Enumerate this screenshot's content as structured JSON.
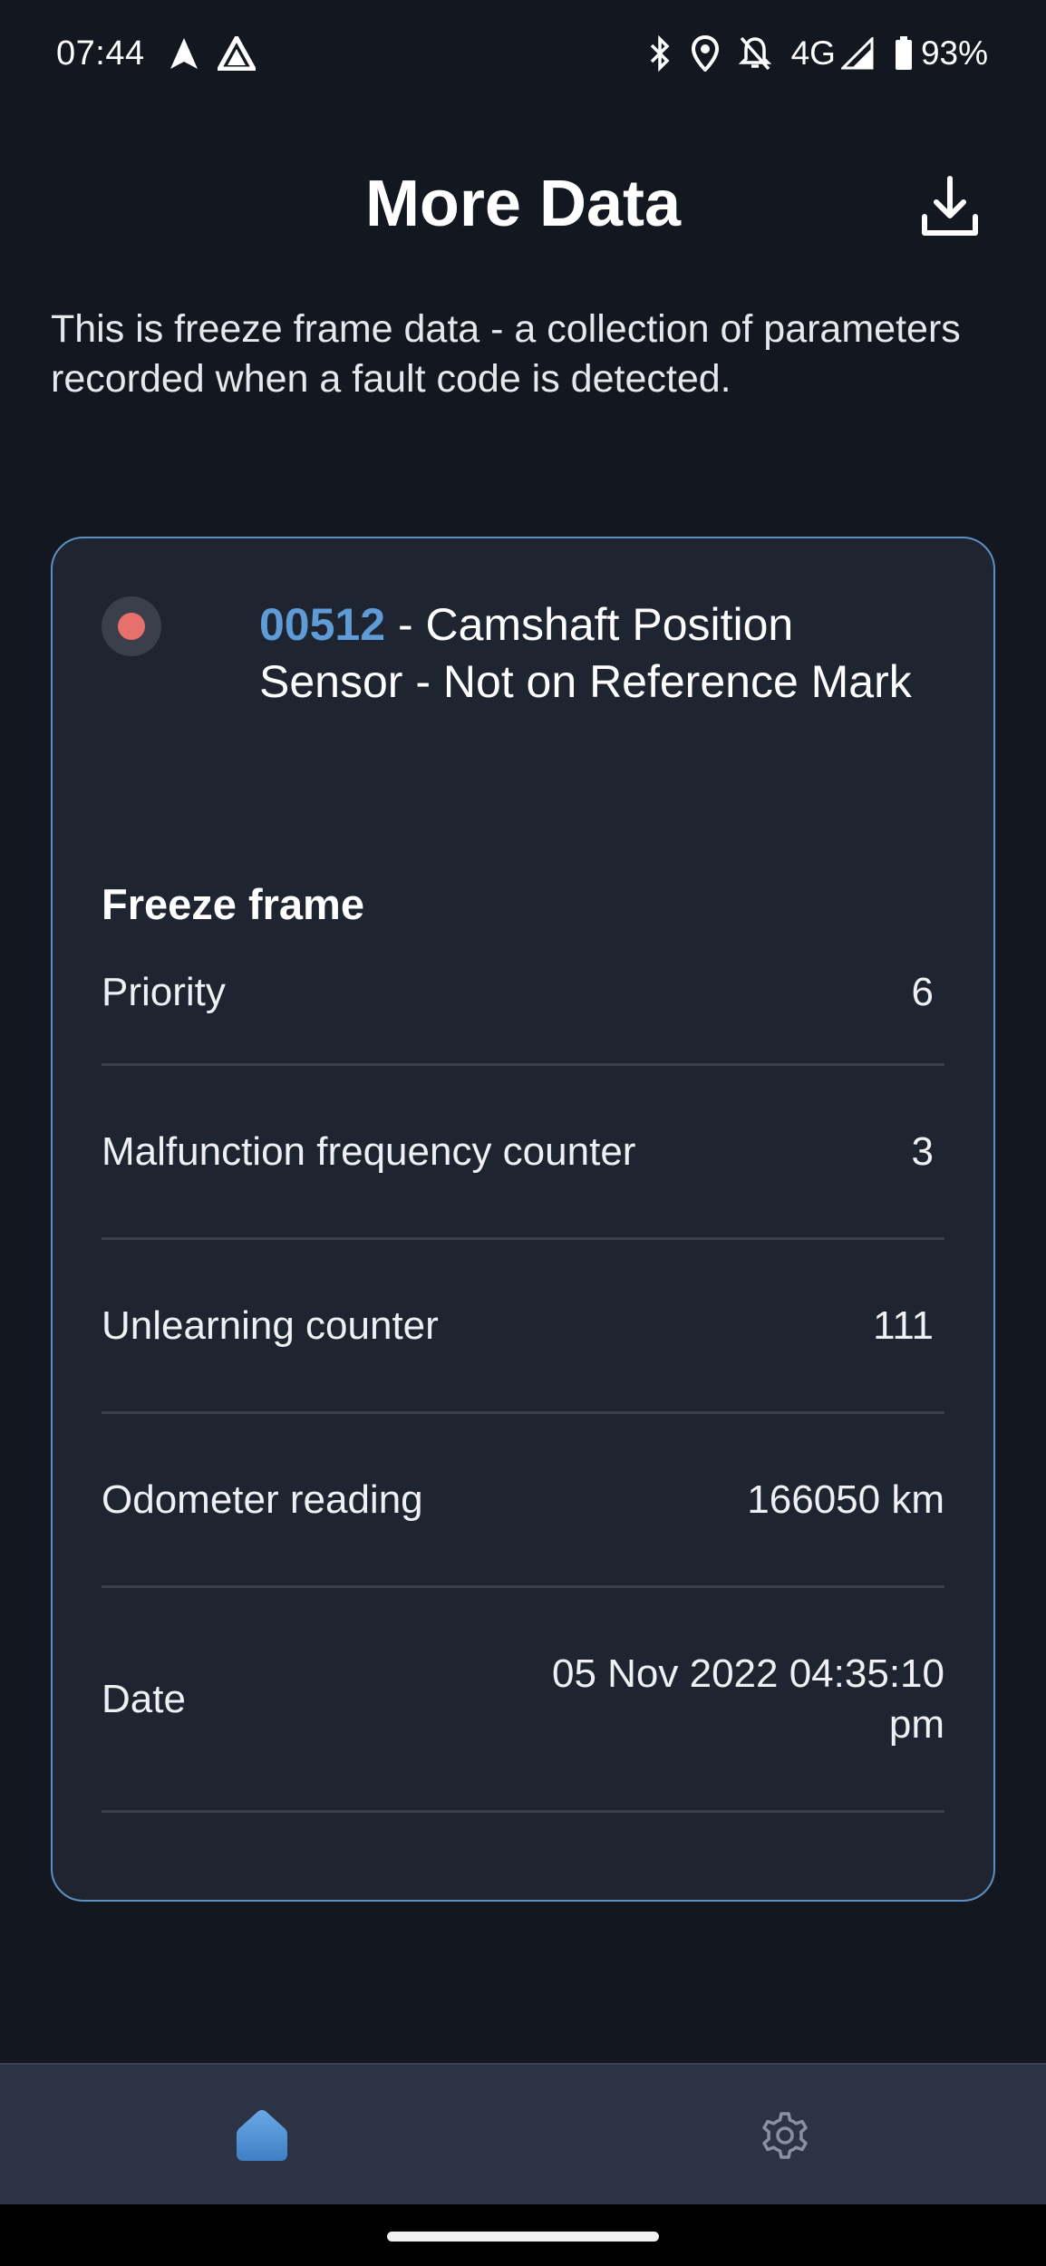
{
  "status_bar": {
    "time": "07:44",
    "network": "4G",
    "battery": "93%",
    "icons": [
      "navigation-icon",
      "app-icon",
      "bluetooth-icon",
      "location-icon",
      "notifications-off-icon",
      "signal-icon",
      "battery-icon"
    ]
  },
  "header": {
    "title": "More Data",
    "download_icon": "download-icon"
  },
  "intro": {
    "text": "This is freeze frame data - a collection of parameters recorded when a fault code is detected."
  },
  "fault": {
    "code": "00512",
    "separator": " - ",
    "description": "Camshaft Position Sensor - Not on Reference Mark",
    "status_color": "#e8706c"
  },
  "freeze_frame": {
    "title": "Freeze frame",
    "rows": [
      {
        "label": "Priority",
        "value": "6"
      },
      {
        "label": "Malfunction frequency counter",
        "value": "3"
      },
      {
        "label": "Unlearning counter",
        "value": "111"
      },
      {
        "label": "Odometer reading",
        "value": "166050 km"
      },
      {
        "label": "Date",
        "value": "05 Nov 2022 04:35:10 pm"
      }
    ]
  },
  "bottom_nav": {
    "items": [
      {
        "name": "home",
        "icon": "home-icon",
        "active": true
      },
      {
        "name": "settings",
        "icon": "gear-icon",
        "active": false
      }
    ]
  },
  "colors": {
    "background": "#13171f",
    "card": "#1f2431",
    "card_border": "#5d90c0",
    "accent": "#5f9bd6",
    "nav_background": "#2c3344"
  }
}
